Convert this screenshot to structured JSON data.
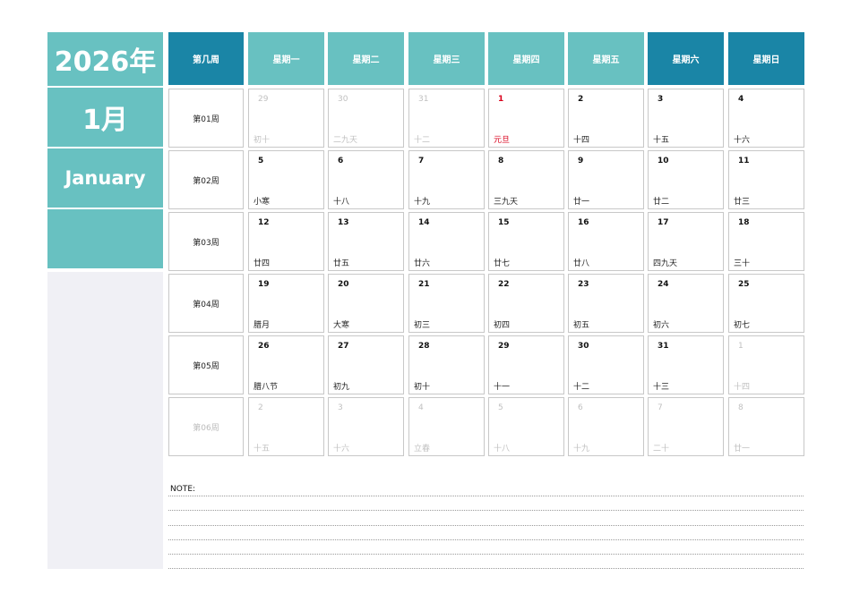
{
  "side": {
    "year": "2026年",
    "month": "1月",
    "month_en": "January"
  },
  "header": {
    "week_col": "第几周",
    "days": [
      "星期一",
      "星期二",
      "星期三",
      "星期四",
      "星期五",
      "星期六",
      "星期日"
    ]
  },
  "colors": {
    "teal_light": "#68c1c1",
    "teal_dark": "#1a85a6",
    "holiday_red": "#d9001b",
    "side_gray": "#f0f0f5"
  },
  "weeks": [
    {
      "label": "第01周",
      "days": [
        {
          "num": "29",
          "lunar": "初十",
          "dim": true
        },
        {
          "num": "30",
          "lunar": "二九天",
          "dim": true
        },
        {
          "num": "31",
          "lunar": "十二",
          "dim": true
        },
        {
          "num": "1",
          "lunar": "元旦",
          "holiday": true
        },
        {
          "num": "2",
          "lunar": "十四"
        },
        {
          "num": "3",
          "lunar": "十五"
        },
        {
          "num": "4",
          "lunar": "十六"
        }
      ]
    },
    {
      "label": "第02周",
      "days": [
        {
          "num": "5",
          "lunar": "小寒"
        },
        {
          "num": "6",
          "lunar": "十八"
        },
        {
          "num": "7",
          "lunar": "十九"
        },
        {
          "num": "8",
          "lunar": "三九天"
        },
        {
          "num": "9",
          "lunar": "廿一"
        },
        {
          "num": "10",
          "lunar": "廿二"
        },
        {
          "num": "11",
          "lunar": "廿三"
        }
      ]
    },
    {
      "label": "第03周",
      "days": [
        {
          "num": "12",
          "lunar": "廿四"
        },
        {
          "num": "13",
          "lunar": "廿五"
        },
        {
          "num": "14",
          "lunar": "廿六"
        },
        {
          "num": "15",
          "lunar": "廿七"
        },
        {
          "num": "16",
          "lunar": "廿八"
        },
        {
          "num": "17",
          "lunar": "四九天"
        },
        {
          "num": "18",
          "lunar": "三十"
        }
      ]
    },
    {
      "label": "第04周",
      "days": [
        {
          "num": "19",
          "lunar": "腊月"
        },
        {
          "num": "20",
          "lunar": "大寒"
        },
        {
          "num": "21",
          "lunar": "初三"
        },
        {
          "num": "22",
          "lunar": "初四"
        },
        {
          "num": "23",
          "lunar": "初五"
        },
        {
          "num": "24",
          "lunar": "初六"
        },
        {
          "num": "25",
          "lunar": "初七"
        }
      ]
    },
    {
      "label": "第05周",
      "days": [
        {
          "num": "26",
          "lunar": "腊八节"
        },
        {
          "num": "27",
          "lunar": "初九"
        },
        {
          "num": "28",
          "lunar": "初十"
        },
        {
          "num": "29",
          "lunar": "十一"
        },
        {
          "num": "30",
          "lunar": "十二"
        },
        {
          "num": "31",
          "lunar": "十三"
        },
        {
          "num": "1",
          "lunar": "十四",
          "dim": true
        }
      ]
    },
    {
      "label": "第06周",
      "dim": true,
      "days": [
        {
          "num": "2",
          "lunar": "十五",
          "dim": true
        },
        {
          "num": "3",
          "lunar": "十六",
          "dim": true
        },
        {
          "num": "4",
          "lunar": "立春",
          "dim": true
        },
        {
          "num": "5",
          "lunar": "十八",
          "dim": true
        },
        {
          "num": "6",
          "lunar": "十九",
          "dim": true
        },
        {
          "num": "7",
          "lunar": "二十",
          "dim": true
        },
        {
          "num": "8",
          "lunar": "廿一",
          "dim": true
        }
      ]
    }
  ],
  "note": {
    "label": "NOTE:"
  }
}
